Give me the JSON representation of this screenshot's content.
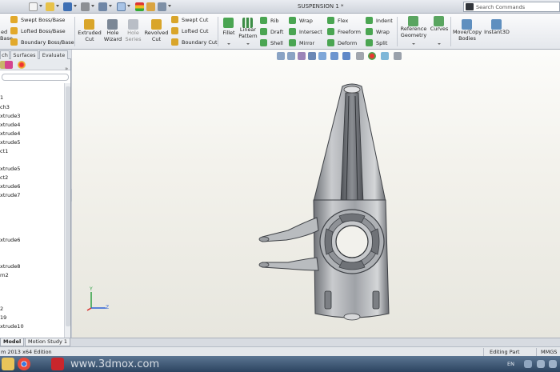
{
  "window": {
    "title": "SUSPENSION 1 *"
  },
  "search": {
    "placeholder": "Search Commands"
  },
  "ribbon": {
    "boss_group": {
      "partial_left_top": "ed",
      "partial_left_bottom": "Base",
      "swept_boss": "Swept Boss/Base",
      "lofted_boss": "Lofted Boss/Base",
      "boundary_boss": "Boundary Boss/Base"
    },
    "extruded_cut": [
      "Extruded",
      "Cut"
    ],
    "hole_wizard": [
      "Hole",
      "Wizard"
    ],
    "hole_series": [
      "Hole",
      "Series"
    ],
    "revolved_cut": [
      "Revolved",
      "Cut"
    ],
    "swept_cut": "Swept Cut",
    "lofted_cut": "Lofted Cut",
    "boundary_cut": "Boundary Cut",
    "fillet": "Fillet",
    "linear_pattern": [
      "Linear",
      "Pattern"
    ],
    "rib": "Rib",
    "draft": "Draft",
    "shell": "Shell",
    "wrap": "Wrap",
    "intersect": "Intersect",
    "mirror": "Mirror",
    "flex": "Flex",
    "freeform": "Freeform",
    "deform": "Deform",
    "indent": "Indent",
    "wrap2": "Wrap",
    "split": "Split",
    "reference_geometry": [
      "Reference",
      "Geometry"
    ],
    "curves": "Curves",
    "move_copy_bodies": [
      "Move/Copy",
      "Bodies"
    ],
    "instant3d": "Instant3D"
  },
  "left_tabs": [
    "ch",
    "Surfaces",
    "Evaluate"
  ],
  "feature_tree": [
    "1",
    "ch3",
    "xtrude3",
    "xtrude4",
    "xtrude4",
    "xtrude5",
    "ct1",
    "xtrude5",
    "ct2",
    "xtrude6",
    "xtrude7",
    "xtrude6",
    "xtrude8",
    "rn2",
    "2",
    "19",
    "xtrude10"
  ],
  "triad": {
    "y": "Y",
    "z": "Z"
  },
  "bottom_tabs": [
    "Model",
    "Motion Study 1"
  ],
  "status": {
    "edition": "m 2013 x64 Edition",
    "mode": "Editing Part",
    "units": "MMGS"
  },
  "taskbar": {
    "language": "EN"
  },
  "watermark": {
    "text": "www.3dmox.com"
  },
  "colors": {
    "ribbon_bg": "#eef0f3",
    "viewport_top": "#fcfcfa",
    "part_gray": "#8d9094",
    "taskbar": "#2c4460"
  }
}
